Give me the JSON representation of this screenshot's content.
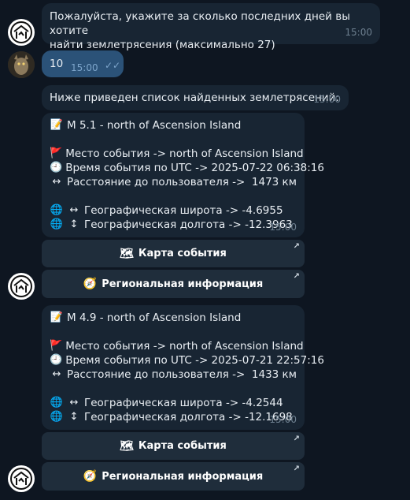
{
  "messages": {
    "prompt": {
      "text_line1": "Пожалуйста, укажите за сколько последних дней вы хотите",
      "text_line2": "найти землетрясения (максимально 27)",
      "time": "15:00"
    },
    "reply": {
      "text": "10",
      "time": "15:00"
    },
    "intro": {
      "text": "Ниже приведен список найденных землетрясений:",
      "time": "15:00"
    }
  },
  "events": [
    {
      "title": "M 5.1 - north of Ascension Island",
      "place": "Место события -> north of Ascension Island",
      "time_utc": "Время события по UTC -> 2025-07-22 06:38:16",
      "distance": "Расстояние до пользователя ->  1473 км",
      "latitude": "Географическая широта -> -4.6955",
      "longitude": "Географическая долгота -> -12.3963",
      "msg_time": "15:00"
    },
    {
      "title": "M 4.9 - north of Ascension Island",
      "place": "Место события -> north of Ascension Island",
      "time_utc": "Время события по UTC -> 2025-07-21 22:57:16",
      "distance": "Расстояние до пользователя ->  1433 км",
      "latitude": "Географическая широта -> -4.2544",
      "longitude": "Географическая долгота -> -12.1698",
      "msg_time": "15:00"
    }
  ],
  "buttons": {
    "map": "Карта события",
    "region": "Региональная информация"
  },
  "icons": {
    "memo": "📝",
    "flag": "🚩",
    "clock": "🕘",
    "left_right": "↔",
    "globe": "🌐",
    "up_down": "↕",
    "map": "🗺",
    "compass": "🧭",
    "external_arrow": "↗"
  },
  "colors": {
    "background": "#0e1621",
    "incoming_bubble": "#182533",
    "outgoing_bubble": "#2b5278",
    "button": "#1f2d3b"
  }
}
